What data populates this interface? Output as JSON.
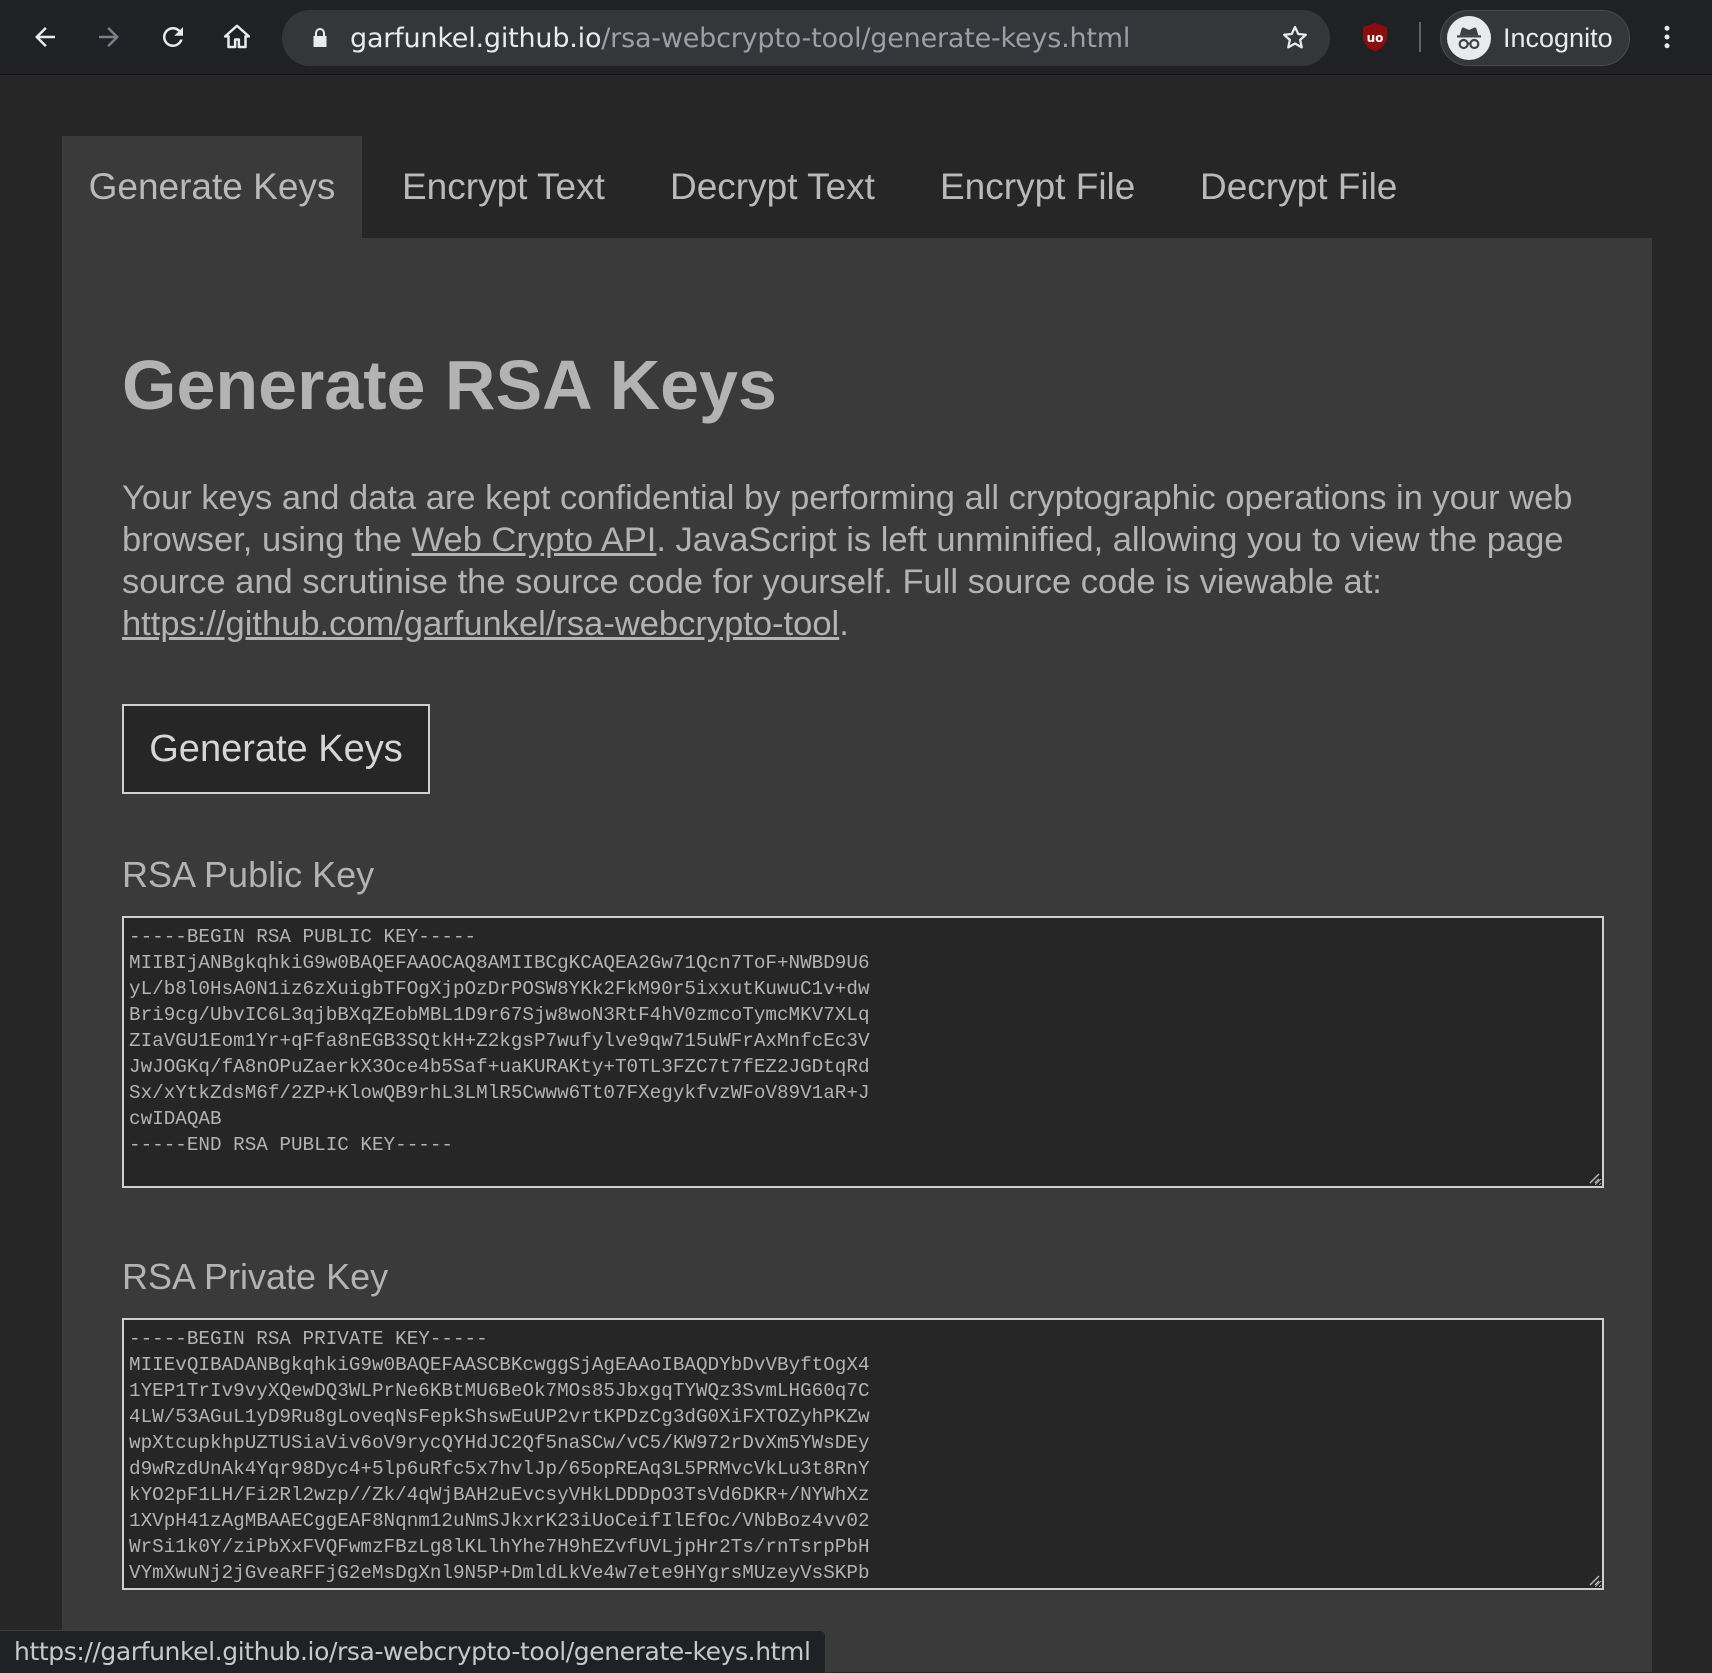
{
  "browser": {
    "url_host": "garfunkel.github.io",
    "url_path": "/rsa-webcrypto-tool/generate-keys.html",
    "profile_label": "Incognito",
    "icons": {
      "back": "back-arrow-icon",
      "forward": "forward-arrow-icon",
      "reload": "reload-icon",
      "home": "home-icon",
      "lock": "lock-icon",
      "bookmark": "star-icon",
      "extension": "ublock-icon",
      "profile": "incognito-icon",
      "menu": "more-vert-icon"
    },
    "status_url": "https://garfunkel.github.io/rsa-webcrypto-tool/generate-keys.html"
  },
  "tabs": [
    {
      "label": "Generate Keys",
      "active": true
    },
    {
      "label": "Encrypt Text",
      "active": false
    },
    {
      "label": "Decrypt Text",
      "active": false
    },
    {
      "label": "Encrypt File",
      "active": false
    },
    {
      "label": "Decrypt File",
      "active": false
    }
  ],
  "page": {
    "title": "Generate RSA Keys",
    "desc_1": "Your keys and data are kept confidential by performing all cryptographic operations in your web browser, using the ",
    "desc_link_1": "Web Crypto API",
    "desc_2": ". JavaScript is left unminified, allowing you to view the page source and scrutinise the source code for yourself. Full source code is viewable at: ",
    "desc_link_2": "https://github.com/garfunkel/rsa-webcrypto-tool",
    "desc_3": ".",
    "generate_button": "Generate Keys",
    "public_label": "RSA Public Key",
    "private_label": "RSA Private Key",
    "public_key": "-----BEGIN RSA PUBLIC KEY-----\nMIIBIjANBgkqhkiG9w0BAQEFAAOCAQ8AMIIBCgKCAQEA2Gw71Qcn7ToF+NWBD9U6\nyL/b8l0HsA0N1iz6zXuigbTFOgXjpOzDrPOSW8YKk2FkM90r5ixxutKuwuC1v+dw\nBri9cg/UbvIC6L3qjbBXqZEobMBL1D9r67Sjw8woN3RtF4hV0zmcoTymcMKV7XLq\nZIaVGU1Eom1Yr+qFfa8nEGB3SQtkH+Z2kgsP7wufylve9qw715uWFrAxMnfcEc3V\nJwJOGKq/fA8nOPuZaerkX3Oce4b5Saf+uaKURAKty+T0TL3FZC7t7fEZ2JGDtqRd\nSx/xYtkZdsM6f/2ZP+KlowQB9rhL3LMlR5Cwww6Tt07FXegykfvzWFoV89V1aR+J\ncwIDAQAB\n-----END RSA PUBLIC KEY-----",
    "private_key": "-----BEGIN RSA PRIVATE KEY-----\nMIIEvQIBADANBgkqhkiG9w0BAQEFAASCBKcwggSjAgEAAoIBAQDYbDvVByftOgX4\n1YEP1TrIv9vyXQewDQ3WLPrNe6KBtMU6BeOk7MOs85JbxgqTYWQz3SvmLHG60q7C\n4LW/53AGuL1yD9Ru8gLoveqNsFepkShswEuUP2vrtKPDzCg3dG0XiFXTOZyhPKZw\nwpXtcupkhpUZTUSiaViv6oV9rycQYHdJC2Qf5naSCw/vC5/KW972rDvXm5YWsDEy\nd9wRzdUnAk4Yqr98Dyc4+5lp6uRfc5x7hvlJp/65opREAq3L5PRMvcVkLu3t8RnY\nkYO2pF1LH/Fi2Rl2wzp//Zk/4qWjBAH2uEvcsyVHkLDDDpO3TsVd6DKR+/NYWhXz\n1XVpH41zAgMBAAECggEAF8Nqnm12uNmSJkxrK23iUoCeifIlEfOc/VNbBoz4vv02\nWrSi1k0Y/ziPbXxFVQFwmzFBzLg8lKLlhYhe7H9hEZvfUVLjpHr2Ts/rnTsrpPbH\nVYmXwuNj2jGveaRFFjG2eMsDgXnl9N5P+DmldLkVe4w7ete9HYgrsMUzeyVsSKPb"
  }
}
